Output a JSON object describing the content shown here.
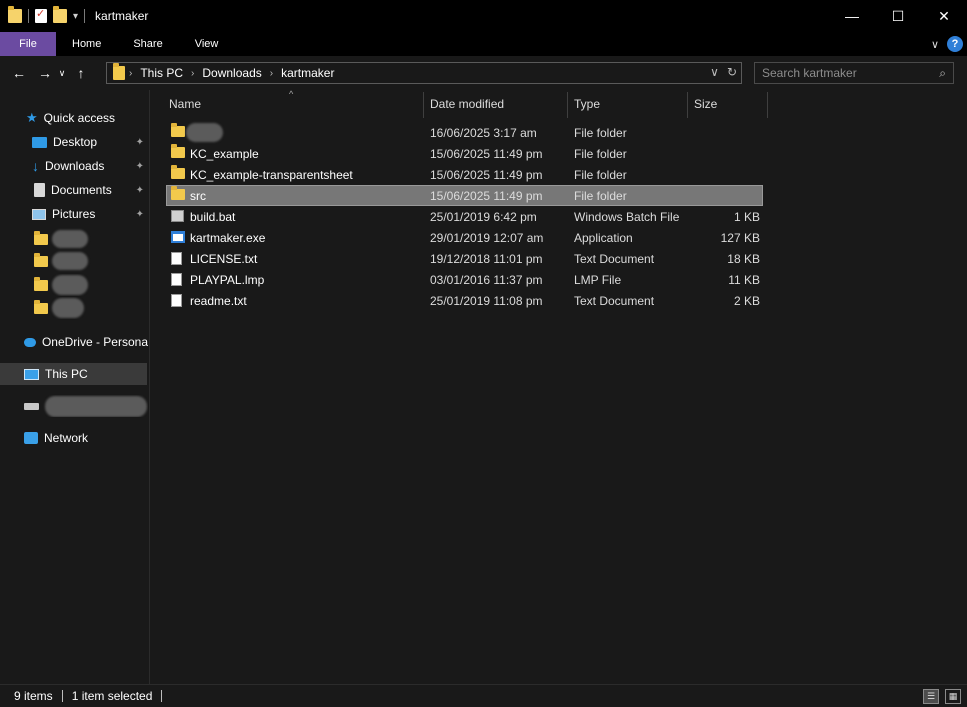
{
  "window": {
    "title": "kartmaker",
    "minimize": "—",
    "maximize": "☐",
    "close": "✕"
  },
  "qat": {
    "icons": [
      "folder-icon",
      "properties-icon",
      "new-folder-icon"
    ],
    "customize": "▾"
  },
  "ribbon": {
    "tabs": [
      "File",
      "Home",
      "Share",
      "View"
    ],
    "expand": "∨",
    "help": "?",
    "file_color": "#6b4ba1"
  },
  "nav": {
    "back": "←",
    "forward": "→",
    "recent": "∨",
    "up": "↑",
    "breadcrumb": [
      "This PC",
      "Downloads",
      "kartmaker"
    ],
    "chevron": "›",
    "dropdown": "∨",
    "refresh": "↻"
  },
  "search": {
    "placeholder": "Search kartmaker",
    "icon": "⌕"
  },
  "sidebar": {
    "quick_access": "Quick access",
    "items": [
      {
        "label": "Desktop",
        "pinned": true,
        "icon": "desktop-icon"
      },
      {
        "label": "Downloads",
        "pinned": true,
        "icon": "downloads-icon"
      },
      {
        "label": "Documents",
        "pinned": true,
        "icon": "documents-icon"
      },
      {
        "label": "Pictures",
        "pinned": true,
        "icon": "pictures-icon"
      }
    ],
    "onedrive": "OneDrive - Persona",
    "this_pc": "This PC",
    "network": "Network",
    "pin_glyph": "📌"
  },
  "columns": {
    "name": "Name",
    "date": "Date modified",
    "type": "Type",
    "size": "Size",
    "sort_glyph": "^"
  },
  "files": [
    {
      "name": "",
      "date": "16/06/2025 3:17 am",
      "type": "File folder",
      "size": "",
      "icon": "folder-icon",
      "blurred": true
    },
    {
      "name": "KC_example",
      "date": "15/06/2025 11:49 pm",
      "type": "File folder",
      "size": "",
      "icon": "folder-icon"
    },
    {
      "name": "KC_example-transparentsheet",
      "date": "15/06/2025 11:49 pm",
      "type": "File folder",
      "size": "",
      "icon": "folder-icon"
    },
    {
      "name": "src",
      "date": "15/06/2025 11:49 pm",
      "type": "File folder",
      "size": "",
      "icon": "folder-icon",
      "selected": true
    },
    {
      "name": "build.bat",
      "date": "25/01/2019 6:42 pm",
      "type": "Windows Batch File",
      "size": "1 KB",
      "icon": "batch-file-icon"
    },
    {
      "name": "kartmaker.exe",
      "date": "29/01/2019 12:07 am",
      "type": "Application",
      "size": "127 KB",
      "icon": "application-icon"
    },
    {
      "name": "LICENSE.txt",
      "date": "19/12/2018 11:01 pm",
      "type": "Text Document",
      "size": "18 KB",
      "icon": "text-file-icon"
    },
    {
      "name": "PLAYPAL.lmp",
      "date": "03/01/2016 11:37 pm",
      "type": "LMP File",
      "size": "11 KB",
      "icon": "file-icon"
    },
    {
      "name": "readme.txt",
      "date": "25/01/2019 11:08 pm",
      "type": "Text Document",
      "size": "2 KB",
      "icon": "text-file-icon"
    }
  ],
  "status": {
    "items": "9 items",
    "selected": "1 item selected",
    "details_view": "☰",
    "tiles_view": "▦"
  }
}
